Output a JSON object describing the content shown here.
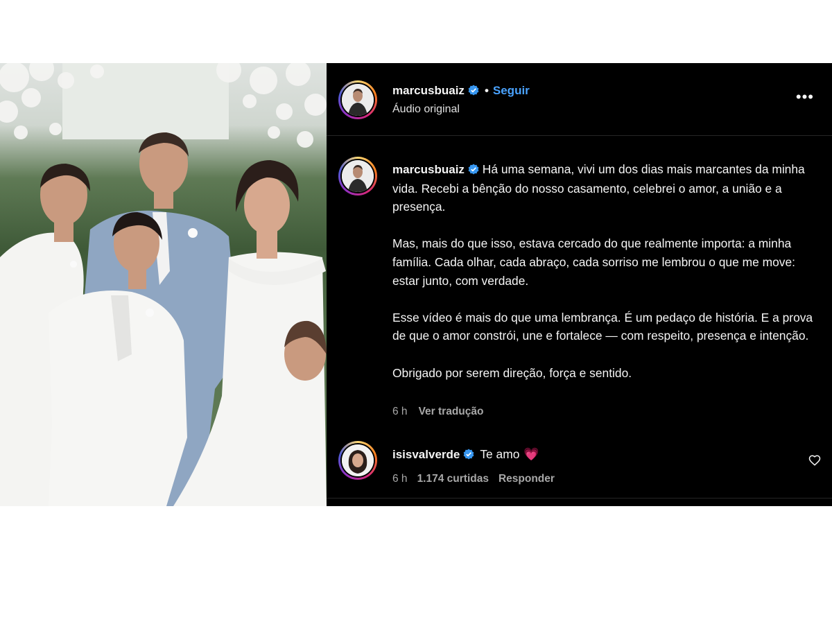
{
  "header": {
    "username": "marcusbuaiz",
    "separator": "•",
    "follow_label": "Seguir",
    "audio_label": "Áudio original",
    "more_icon": "more-horizontal-icon",
    "more_glyph": "•••"
  },
  "caption": {
    "username": "marcusbuaiz",
    "paragraphs": [
      "Há uma semana, vivi um dos dias mais marcantes da minha vida. Recebi a bênção do nosso casamento, celebrei o amor, a união e a presença.",
      "Mas, mais do que isso, estava cercado do que realmente importa: a minha família. Cada olhar, cada abraço, cada sorriso me lembrou o que me move: estar junto, com verdade.",
      "Esse vídeo é mais do que uma lembrança. É um pedaço de história. E a prova de que o amor constrói, une e fortalece — com respeito, presença e intenção.",
      "Obrigado por serem direção, força e sentido."
    ],
    "time": "6 h",
    "translate_label": "Ver tradução"
  },
  "comment": {
    "username": "isisvalverde",
    "text": "Te amo",
    "emoji": "💗",
    "time": "6 h",
    "likes": "1.174 curtidas",
    "reply_label": "Responder",
    "like_icon": "heart-outline-icon"
  },
  "colors": {
    "background": "#000000",
    "text": "#f5f5f5",
    "secondary_text": "#a8a8a8",
    "follow_blue": "#4aa3ff",
    "verified_blue": "#3897f0"
  }
}
